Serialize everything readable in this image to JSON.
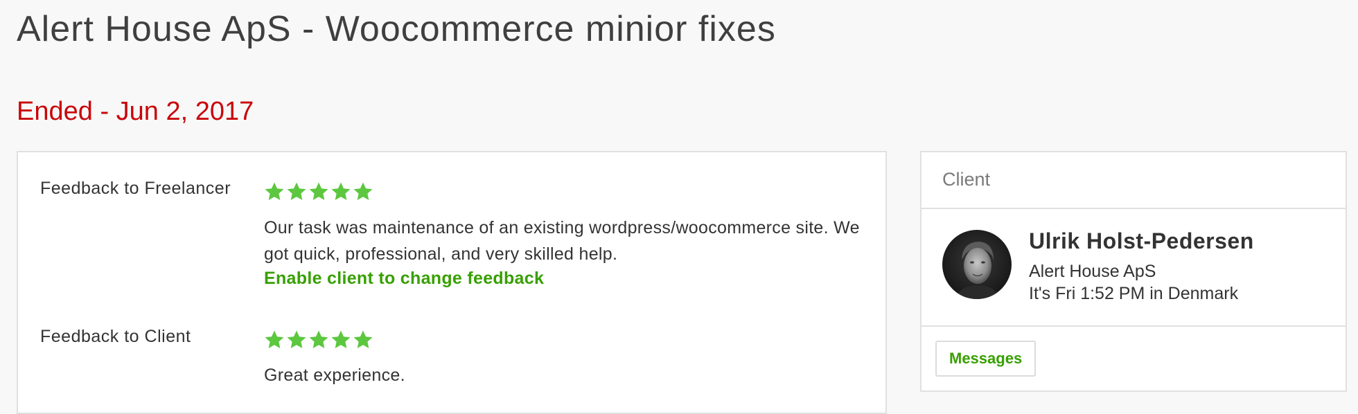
{
  "page": {
    "title": "Alert House ApS - Woocommerce minior fixes",
    "status": "Ended - Jun 2, 2017",
    "status_color": "#c9060a"
  },
  "feedback": {
    "freelancer": {
      "label": "Feedback to Freelancer",
      "rating": 5,
      "max_rating": 5,
      "comment": "Our task was maintenance of an existing wordpress/woocommerce site. We got quick, professional, and very skilled help.",
      "action_link": "Enable client to change feedback"
    },
    "client": {
      "label": "Feedback to Client",
      "rating": 5,
      "max_rating": 5,
      "comment": "Great experience."
    },
    "star_color": "#5cc73f",
    "link_color": "#37a000"
  },
  "client_card": {
    "header": "Client",
    "name": "Ulrik Holst-Pedersen",
    "company": "Alert House ApS",
    "local_time": "It's Fri 1:52 PM in Denmark",
    "messages_button": "Messages"
  }
}
